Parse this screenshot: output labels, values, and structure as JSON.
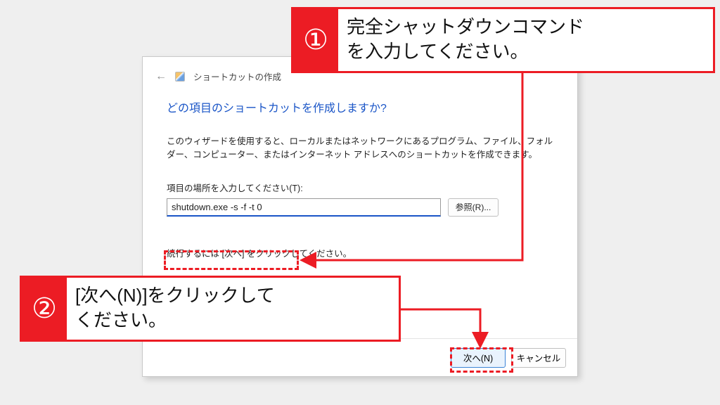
{
  "dialog": {
    "window_title": "ショートカットの作成",
    "heading": "どの項目のショートカットを作成しますか?",
    "description": "このウィザードを使用すると、ローカルまたはネットワークにあるプログラム、ファイル、フォルダー、コンピューター、またはインターネット アドレスへのショートカットを作成できます。",
    "field_label": "項目の場所を入力してください(T):",
    "input_value": "shutdown.exe -s -f -t 0",
    "browse_label": "参照(R)...",
    "continue_text": "続行するには [次へ] をクリックしてください。",
    "next_label": "次へ(N)",
    "cancel_label": "キャンセル"
  },
  "annotations": {
    "step1_number": "①",
    "step1_text": "完全シャットダウンコマンド\nを入力してください。",
    "step2_number": "②",
    "step2_text": "[次へ(N)]をクリックして\nください。"
  }
}
